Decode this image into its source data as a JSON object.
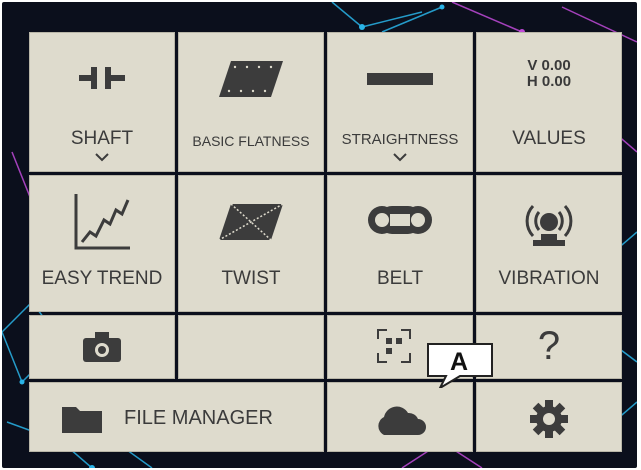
{
  "tiles": {
    "shaft": {
      "label": "SHAFT",
      "icon": "coupling-icon",
      "has_dropdown": true
    },
    "basic_flatness": {
      "label": "BASIC FLATNESS",
      "icon": "flatness-plane-icon"
    },
    "straightness": {
      "label": "STRAIGHTNESS",
      "icon": "straight-bar-icon",
      "has_dropdown": true
    },
    "values": {
      "label": "VALUES",
      "v_line": "V 0.00",
      "h_line": "H 0.00"
    },
    "easy_trend": {
      "label": "EASY TREND",
      "icon": "trend-chart-icon"
    },
    "twist": {
      "label": "TWIST",
      "icon": "twist-plane-icon"
    },
    "belt": {
      "label": "BELT",
      "icon": "belt-pulley-icon"
    },
    "vibration": {
      "label": "VIBRATION",
      "icon": "vibration-sensor-icon"
    },
    "camera": {
      "icon": "camera-icon"
    },
    "blank": {},
    "scan": {
      "icon": "qr-scan-icon"
    },
    "help": {
      "label": "?",
      "icon": "question-icon"
    },
    "file_manager": {
      "label": "FILE MANAGER",
      "icon": "folder-icon"
    },
    "cloud": {
      "icon": "cloud-icon"
    },
    "settings": {
      "icon": "gear-icon"
    }
  },
  "callout": {
    "label": "A"
  },
  "colors": {
    "tile": "#dedbcd",
    "icon": "#3c3c3c",
    "background": "#0b0f1c"
  }
}
